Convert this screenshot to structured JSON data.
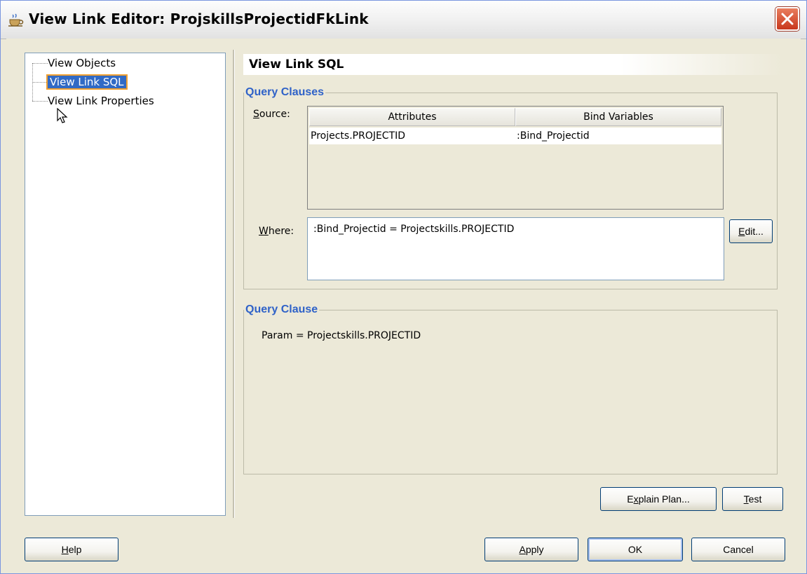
{
  "window": {
    "title": "View Link Editor: ProjskillsProjectidFkLink"
  },
  "nav": {
    "items": [
      {
        "label": "View Objects"
      },
      {
        "label": "View Link SQL",
        "selected": true
      },
      {
        "label": "View Link Properties"
      }
    ]
  },
  "panel": {
    "title": "View Link SQL",
    "query_clauses": {
      "legend": "Query Clauses",
      "source_label": "Source:",
      "where_label": "Where:",
      "columns": [
        "Attributes",
        "Bind Variables"
      ],
      "rows": [
        {
          "attribute": "Projects.PROJECTID",
          "bind_variable": ":Bind_Projectid"
        }
      ],
      "where_value": ":Bind_Projectid = Projectskills.PROJECTID",
      "edit_button": "Edit..."
    },
    "query_clause": {
      "legend": "Query Clause",
      "text": "Param = Projectskills.PROJECTID"
    }
  },
  "buttons": {
    "explain_plan": "Explain Plan...",
    "test": "Test",
    "help": "Help",
    "apply": "Apply",
    "ok": "OK",
    "cancel": "Cancel"
  },
  "colors": {
    "selection": "#316ac5",
    "legend": "#2f62c8",
    "close_button": "#c8371c"
  }
}
